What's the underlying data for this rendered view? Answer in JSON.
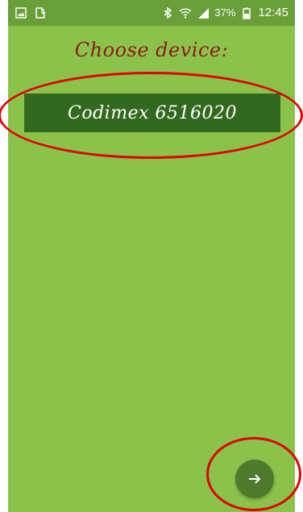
{
  "status_bar": {
    "battery_text": "37%",
    "time": "12:45",
    "icons": [
      "gallery-icon",
      "download-icon",
      "bluetooth-icon",
      "wifi-icon",
      "signal-icon",
      "battery-icon"
    ]
  },
  "screen": {
    "title": "Choose device:",
    "devices": [
      {
        "label": "Codimex 6516020"
      }
    ],
    "next_button": {
      "icon": "arrow-right-icon"
    }
  },
  "colors": {
    "background": "#8bc34a",
    "status_bar": "#689f38",
    "device_button": "#33691e",
    "title_text": "#8b1a1a",
    "fab": "#4f7a2e",
    "annotation": "#e00000"
  }
}
